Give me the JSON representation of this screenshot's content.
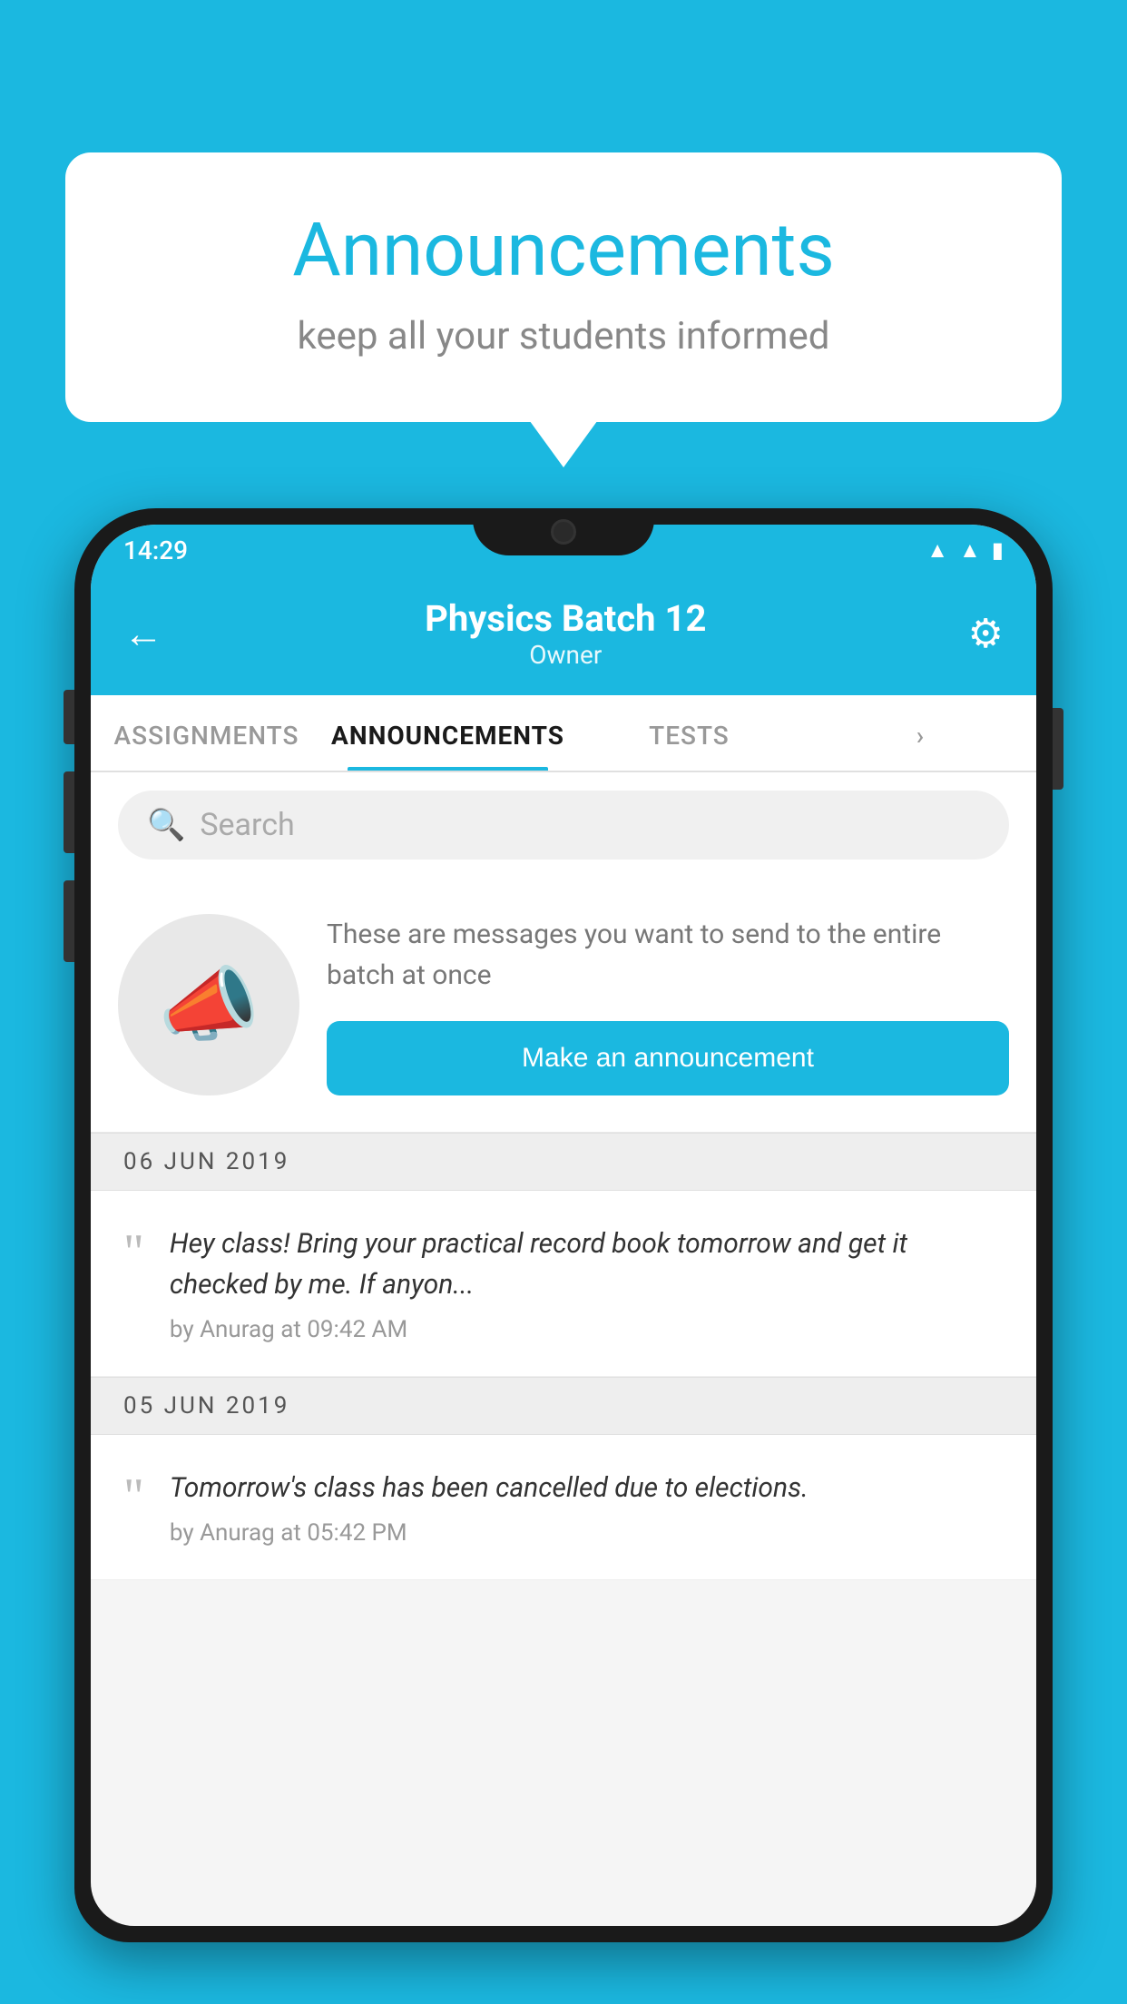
{
  "page": {
    "background_color": "#1BB8E0"
  },
  "speech_bubble": {
    "title": "Announcements",
    "subtitle": "keep all your students informed"
  },
  "phone": {
    "status_bar": {
      "time": "14:29",
      "wifi": "wifi",
      "signal": "signal",
      "battery": "battery"
    },
    "header": {
      "title": "Physics Batch 12",
      "subtitle": "Owner",
      "back_label": "←",
      "settings_label": "⚙"
    },
    "tabs": [
      {
        "label": "ASSIGNMENTS",
        "active": false
      },
      {
        "label": "ANNOUNCEMENTS",
        "active": true
      },
      {
        "label": "TESTS",
        "active": false
      },
      {
        "label": "›",
        "active": false
      }
    ],
    "search": {
      "placeholder": "Search"
    },
    "promo": {
      "text": "These are messages you want to send to the entire batch at once",
      "button_label": "Make an announcement"
    },
    "announcements": [
      {
        "date": "06  JUN  2019",
        "text": "Hey class! Bring your practical record book tomorrow and get it checked by me. If anyon...",
        "meta": "by Anurag at 09:42 AM"
      },
      {
        "date": "05  JUN  2019",
        "text": "Tomorrow's class has been cancelled due to elections.",
        "meta": "by Anurag at 05:42 PM"
      }
    ]
  }
}
